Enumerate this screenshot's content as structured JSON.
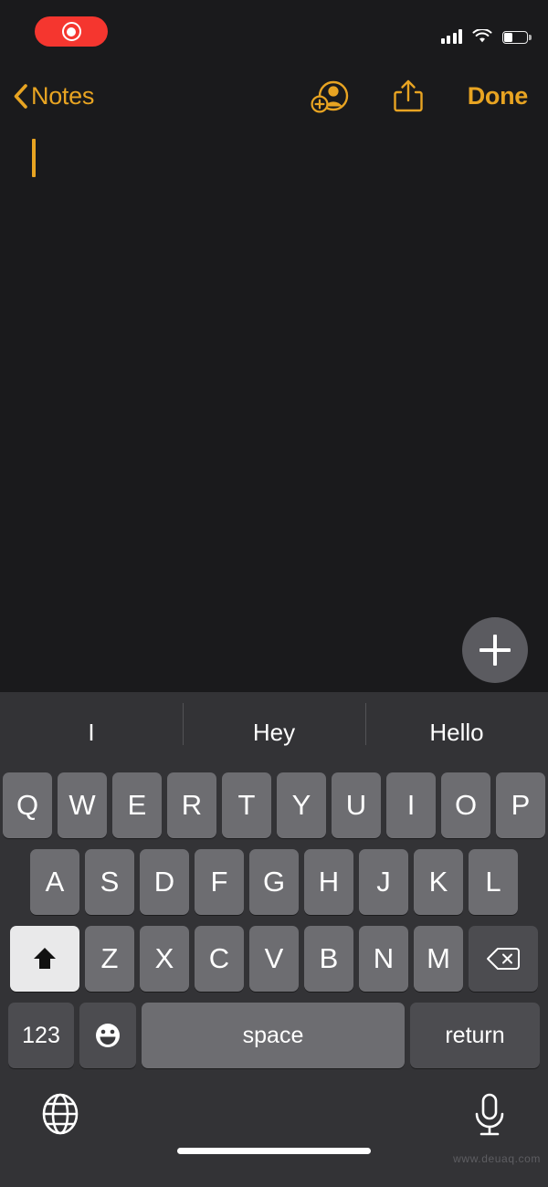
{
  "status_bar": {
    "recording_indicator": {
      "icon": "screen-record-icon",
      "color": "#f5362f",
      "label": ""
    },
    "cellular": {
      "icon": "cellular-bars-icon",
      "bars_filled": 4,
      "bars_total": 4
    },
    "wifi": {
      "icon": "wifi-icon",
      "strength": 3
    },
    "battery": {
      "icon": "battery-icon",
      "level_percent": 30
    }
  },
  "nav_bar": {
    "back_icon": "chevron-left-icon",
    "back_label": "Notes",
    "add_person_icon": "add-person-icon",
    "share_icon": "share-icon",
    "done_label": "Done",
    "accent_color": "#e8a422"
  },
  "note": {
    "body_text": "",
    "caret_visible": true,
    "add_attachment_icon": "plus-icon",
    "background_color": "#1a1a1c"
  },
  "keyboard": {
    "background_color": "#333336",
    "key_color": "#6d6d71",
    "dark_key_color": "#4c4c50",
    "suggestions": [
      "I",
      "Hey",
      "Hello"
    ],
    "rows": {
      "row1": [
        "Q",
        "W",
        "E",
        "R",
        "T",
        "Y",
        "U",
        "I",
        "O",
        "P"
      ],
      "row2": [
        "A",
        "S",
        "D",
        "F",
        "G",
        "H",
        "J",
        "K",
        "L"
      ],
      "row3": [
        "Z",
        "X",
        "C",
        "V",
        "B",
        "N",
        "M"
      ]
    },
    "shift_key": {
      "icon": "shift-arrow-icon",
      "active": true
    },
    "delete_key": {
      "icon": "backspace-icon"
    },
    "numbers_key_label": "123",
    "emoji_key": {
      "icon": "emoji-smiley-icon"
    },
    "space_key_label": "space",
    "return_key_label": "return",
    "globe_key": {
      "icon": "globe-icon"
    },
    "dictation_key": {
      "icon": "microphone-icon"
    }
  },
  "home_indicator": {
    "visible": true
  },
  "watermark": {
    "text": "www.deuaq.com"
  }
}
